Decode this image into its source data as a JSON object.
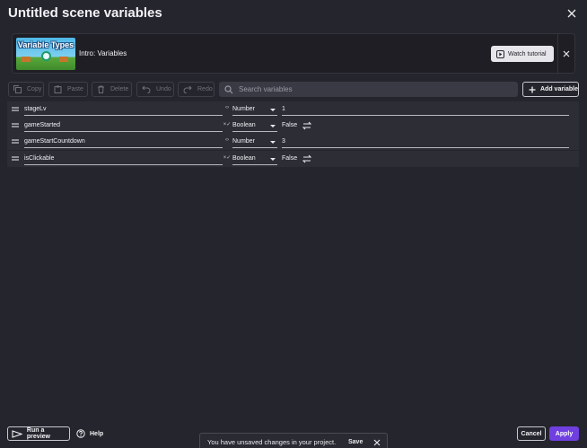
{
  "dialog": {
    "title": "Untitled scene variables"
  },
  "tutorial": {
    "thumbnail_text": "Variable Types",
    "name": "Intro: Variables",
    "watch_label": "Watch tutorial"
  },
  "toolbar": {
    "copy": "Copy",
    "paste": "Paste",
    "delete": "Delete",
    "undo": "Undo",
    "redo": "Redo",
    "search_placeholder": "Search variables",
    "add_variable": "Add variable"
  },
  "variables": [
    {
      "name": "stageLv",
      "type_icon": "‹›",
      "type": "Number",
      "value": "1"
    },
    {
      "name": "gameStarted",
      "type_icon": "×✓",
      "type": "Boolean",
      "value": "False"
    },
    {
      "name": "gameStartCountdown",
      "type_icon": "‹›",
      "type": "Number",
      "value": "3"
    },
    {
      "name": "isClickable",
      "type_icon": "×✓",
      "type": "Boolean",
      "value": "False"
    }
  ],
  "footer": {
    "run_preview": "Run a preview",
    "help": "Help",
    "unsaved_message": "You have unsaved changes in your project.",
    "save": "Save",
    "cancel": "Cancel",
    "apply": "Apply"
  },
  "colors": {
    "background": "#25252d",
    "row": "#2d2d36",
    "accent": "#6f3fe0"
  }
}
